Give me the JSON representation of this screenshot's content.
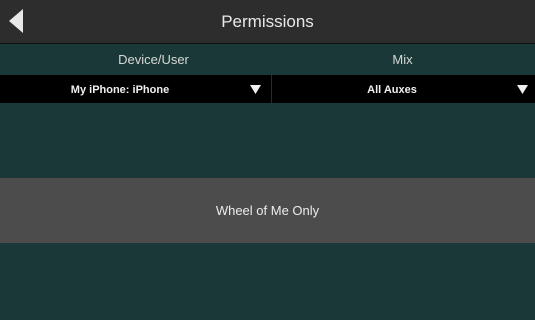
{
  "header": {
    "title": "Permissions",
    "back_icon": "back-arrow-icon"
  },
  "columns": {
    "left_label": "Device/User",
    "right_label": "Mix"
  },
  "selects": {
    "device_value": "My iPhone: iPhone",
    "mix_value": "All Auxes",
    "arrow_icon": "triangle-down-icon"
  },
  "rows": {
    "wheel_label": "Wheel of Me Only"
  },
  "colors": {
    "background": "#1a3838",
    "titlebar": "#2d2d2d",
    "selected_row": "#4c4c4c",
    "select_bg": "#000000"
  }
}
